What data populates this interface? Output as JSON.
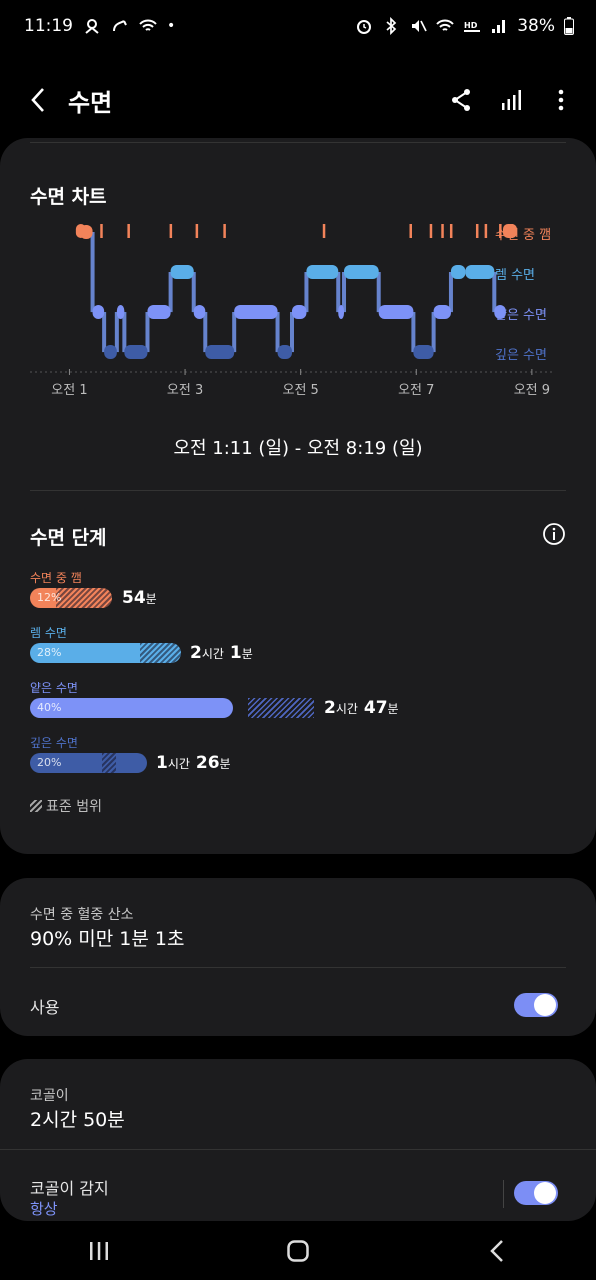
{
  "status": {
    "time": "11:19",
    "battery": "38%"
  },
  "header": {
    "title": "수면"
  },
  "sleep_chart": {
    "title": "수면 차트",
    "legend": {
      "awake": "수면 중 깸",
      "rem": "렘 수면",
      "light": "얕은 수면",
      "deep": "깊은 수면"
    },
    "x_ticks": [
      "오전 1",
      "오전 3",
      "오전 5",
      "오전 7",
      "오전 9"
    ],
    "time_range": "오전 1:11 (일) - 오전 8:19 (일)"
  },
  "chart_data": {
    "type": "hypnogram",
    "x_range_hours": [
      0.75,
      9.4
    ],
    "levels": [
      "awake",
      "rem",
      "light",
      "deep"
    ],
    "segments": [
      {
        "start": 1.18,
        "end": 1.4,
        "stage": "awake"
      },
      {
        "start": 1.4,
        "end": 1.6,
        "stage": "light"
      },
      {
        "start": 1.6,
        "end": 1.82,
        "stage": "deep"
      },
      {
        "start": 1.82,
        "end": 1.95,
        "stage": "light"
      },
      {
        "start": 1.95,
        "end": 2.35,
        "stage": "deep"
      },
      {
        "start": 2.35,
        "end": 2.75,
        "stage": "light"
      },
      {
        "start": 2.75,
        "end": 3.15,
        "stage": "rem"
      },
      {
        "start": 3.15,
        "end": 3.35,
        "stage": "light"
      },
      {
        "start": 3.35,
        "end": 3.85,
        "stage": "deep"
      },
      {
        "start": 3.85,
        "end": 4.6,
        "stage": "light"
      },
      {
        "start": 4.6,
        "end": 4.85,
        "stage": "deep"
      },
      {
        "start": 4.85,
        "end": 5.1,
        "stage": "light"
      },
      {
        "start": 5.1,
        "end": 5.65,
        "stage": "rem"
      },
      {
        "start": 5.65,
        "end": 5.75,
        "stage": "light"
      },
      {
        "start": 5.75,
        "end": 6.35,
        "stage": "rem"
      },
      {
        "start": 6.35,
        "end": 6.95,
        "stage": "light"
      },
      {
        "start": 6.95,
        "end": 7.3,
        "stage": "deep"
      },
      {
        "start": 7.3,
        "end": 7.6,
        "stage": "light"
      },
      {
        "start": 7.6,
        "end": 7.85,
        "stage": "rem"
      },
      {
        "start": 7.85,
        "end": 8.35,
        "stage": "rem"
      },
      {
        "start": 8.35,
        "end": 8.55,
        "stage": "light"
      }
    ],
    "awake_marks": [
      1.55,
      2.02,
      2.75,
      3.2,
      3.68,
      5.4,
      6.9,
      7.25,
      7.45,
      7.6,
      8.05,
      8.2,
      8.45,
      8.65
    ]
  },
  "stages": {
    "title": "수면 단계",
    "items": [
      {
        "label": "수면 중 깸",
        "pct": "12%",
        "dur_h": "",
        "dur_h_unit": "",
        "dur_m": "54",
        "dur_m_unit": "분"
      },
      {
        "label": "렘 수면",
        "pct": "28%",
        "dur_h": "2",
        "dur_h_unit": "시간",
        "dur_m": "1",
        "dur_m_unit": "분"
      },
      {
        "label": "얕은 수면",
        "pct": "40%",
        "dur_h": "2",
        "dur_h_unit": "시간",
        "dur_m": "47",
        "dur_m_unit": "분"
      },
      {
        "label": "깊은 수면",
        "pct": "20%",
        "dur_h": "1",
        "dur_h_unit": "시간",
        "dur_m": "26",
        "dur_m_unit": "분"
      }
    ],
    "bar_fraction": [
      0.12,
      0.28,
      0.4,
      0.2
    ],
    "normal_range_label": "표준 범위"
  },
  "spo2": {
    "label": "수면 중 혈중 산소",
    "value": "90% 미만 1분 1초",
    "toggle_label": "사용",
    "toggle_on": true
  },
  "snoring": {
    "label": "코골이",
    "value": "2시간 50분",
    "detect_label": "코골이 감지",
    "detect_sub": "항상",
    "toggle_on": true
  },
  "colors": {
    "awake": "#f2835a",
    "rem": "#5aaee8",
    "light": "#7d92f7",
    "deep": "#3e5ca6",
    "card": "#1c1c1e"
  }
}
